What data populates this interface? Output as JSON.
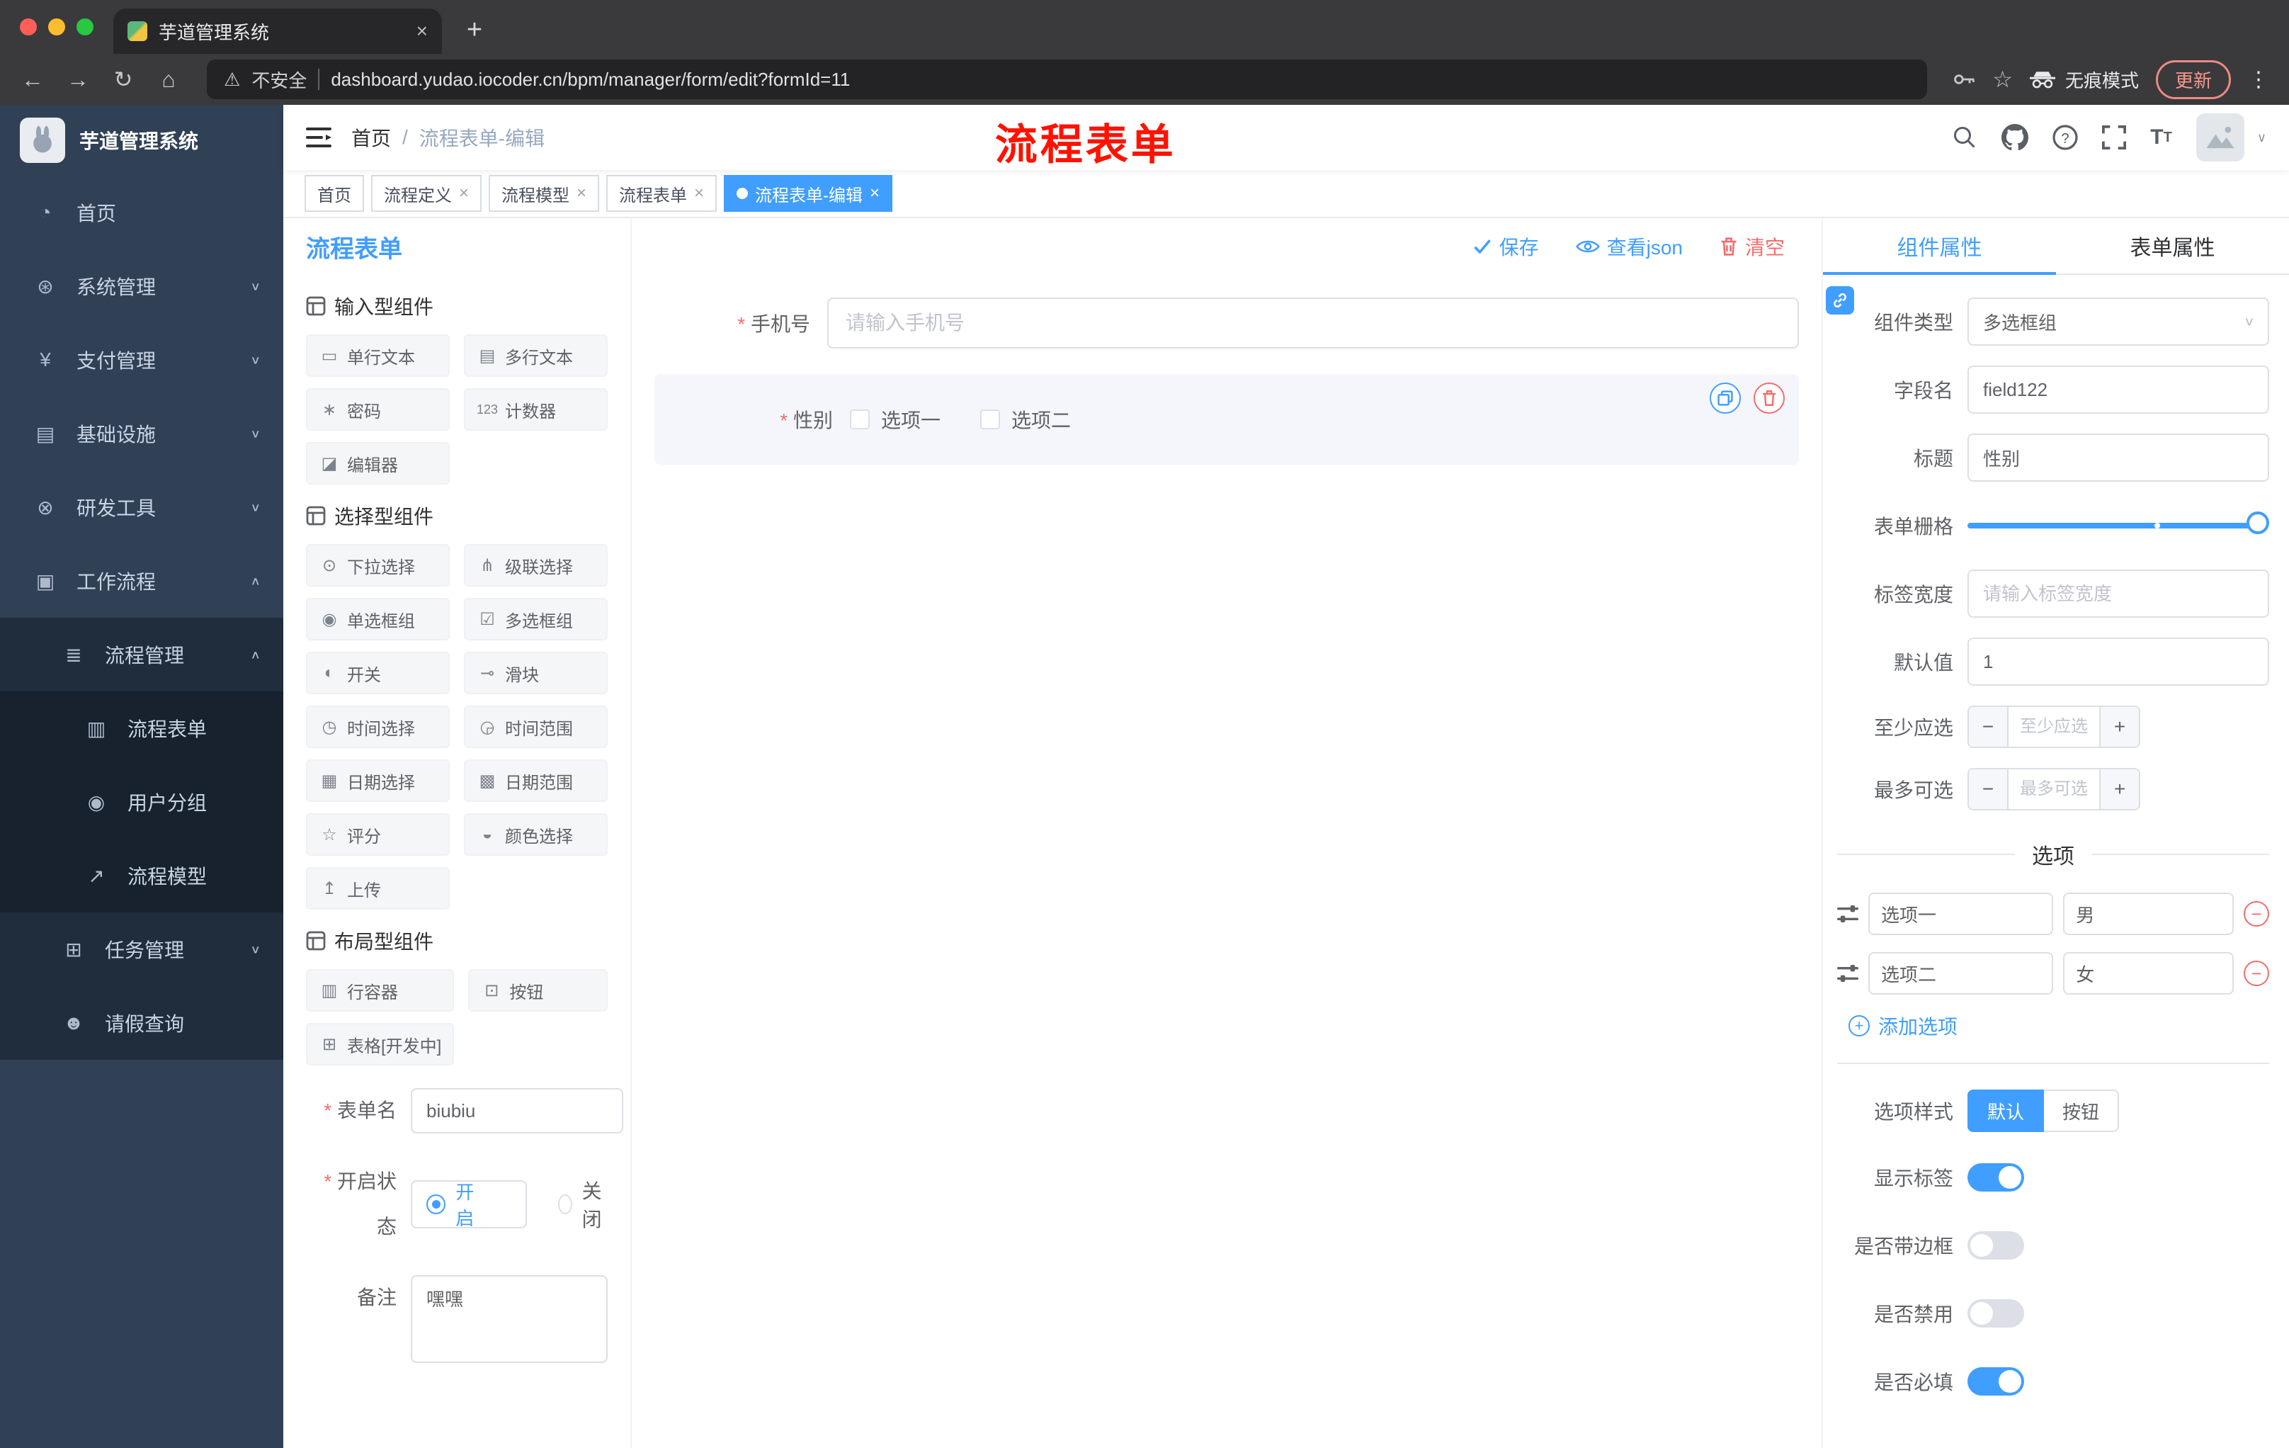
{
  "ui": {
    "close": "×",
    "plus": "+",
    "minus": "−",
    "chevron_down": "∨",
    "chevron_up": "∧",
    "kebab": "⋮",
    "warning": "⚠",
    "star": "☆",
    "nav_back": "←",
    "nav_forward": "→",
    "nav_reload": "↻",
    "nav_home": "⌂",
    "new_tab": "+",
    "caret": "∨"
  },
  "colors": {
    "accent": "#409eff",
    "danger": "#f56c6c",
    "sidebar": "#304156",
    "annotation": "#fe1200"
  },
  "browser": {
    "tab_title": "芋道管理系统",
    "security": "不安全",
    "url": "dashboard.yudao.iocoder.cn/bpm/manager/form/edit?formId=11",
    "incognito": "无痕模式",
    "update": "更新"
  },
  "sidebar": {
    "title": "芋道管理系统",
    "items": [
      {
        "glyph": "◔",
        "label": "首页"
      },
      {
        "glyph": "⊛",
        "label": "系统管理",
        "arrow": "∨"
      },
      {
        "glyph": "¥",
        "label": "支付管理",
        "arrow": "∨"
      },
      {
        "glyph": "▤",
        "label": "基础设施",
        "arrow": "∨"
      },
      {
        "glyph": "⊗",
        "label": "研发工具",
        "arrow": "∨"
      },
      {
        "glyph": "▣",
        "label": "工作流程",
        "arrow": "∧"
      },
      {
        "glyph": "≣",
        "label": "流程管理",
        "arrow": "∧"
      },
      {
        "glyph": "▥",
        "label": "流程表单"
      },
      {
        "glyph": "◉",
        "label": "用户分组"
      },
      {
        "glyph": "↗",
        "label": "流程模型"
      },
      {
        "glyph": "⊞",
        "label": "任务管理",
        "arrow": "∨"
      },
      {
        "glyph": "☻",
        "label": "请假查询"
      }
    ]
  },
  "header": {
    "breadcrumb_home": "首页",
    "breadcrumb_sep": "/",
    "breadcrumb_current": "流程表单-编辑",
    "annotation": "流程表单"
  },
  "tags": [
    {
      "label": "首页"
    },
    {
      "label": "流程定义"
    },
    {
      "label": "流程模型"
    },
    {
      "label": "流程表单"
    },
    {
      "label": "流程表单-编辑"
    }
  ],
  "designer": {
    "title": "流程表单",
    "save": "保存",
    "view_json": "查看json",
    "clear": "清空",
    "groups": [
      {
        "title": "输入型组件",
        "items": [
          {
            "glyph": "▭",
            "label": "单行文本"
          },
          {
            "glyph": "▤",
            "label": "多行文本"
          },
          {
            "glyph": "∗",
            "label": "密码"
          },
          {
            "glyph": "123",
            "label": "计数器"
          },
          {
            "glyph": "◪",
            "label": "编辑器"
          }
        ]
      },
      {
        "title": "选择型组件",
        "items": [
          {
            "glyph": "⊙",
            "label": "下拉选择"
          },
          {
            "glyph": "⋔",
            "label": "级联选择"
          },
          {
            "glyph": "◉",
            "label": "单选框组"
          },
          {
            "glyph": "☑",
            "label": "多选框组"
          },
          {
            "glyph": "◐",
            "label": "开关"
          },
          {
            "glyph": "⊸",
            "label": "滑块"
          },
          {
            "glyph": "◷",
            "label": "时间选择"
          },
          {
            "glyph": "◶",
            "label": "时间范围"
          },
          {
            "glyph": "▦",
            "label": "日期选择"
          },
          {
            "glyph": "▩",
            "label": "日期范围"
          },
          {
            "glyph": "☆",
            "label": "评分"
          },
          {
            "glyph": "◒",
            "label": "颜色选择"
          },
          {
            "glyph": "↥",
            "label": "上传"
          }
        ]
      },
      {
        "title": "布局型组件",
        "items": [
          {
            "glyph": "▥",
            "label": "行容器"
          },
          {
            "glyph": "⊡",
            "label": "按钮"
          },
          {
            "glyph": "⊞",
            "label": "表格[开发中]"
          }
        ]
      }
    ],
    "meta": {
      "name_label": "表单名",
      "name_value": "biubiu",
      "status_label": "开启状态",
      "on": "开启",
      "off": "关闭",
      "remark_label": "备注",
      "remark_value": "嘿嘿"
    },
    "canvas": {
      "phone_label": "手机号",
      "phone_placeholder": "请输入手机号",
      "gender_label": "性别",
      "opt1": "选项一",
      "opt2": "选项二"
    }
  },
  "props": {
    "tab_component": "组件属性",
    "tab_form": "表单属性",
    "rows": {
      "type_label": "组件类型",
      "type_value": "多选框组",
      "field_label": "字段名",
      "field_value": "field122",
      "title_label": "标题",
      "title_value": "性别",
      "grid_label": "表单栅格",
      "label_width_label": "标签宽度",
      "label_width_placeholder": "请输入标签宽度",
      "default_label": "默认值",
      "default_value": "1",
      "min_label": "至少应选",
      "min_placeholder": "至少应选",
      "max_label": "最多可选",
      "max_placeholder": "最多可选"
    },
    "options": {
      "title": "选项",
      "rows": [
        {
          "label": "选项一",
          "value": "男"
        },
        {
          "label": "选项二",
          "value": "女"
        }
      ],
      "add": "添加选项"
    },
    "style": {
      "label": "选项样式",
      "default": "默认",
      "button": "按钮"
    },
    "switches": [
      {
        "label": "显示标签",
        "on": true
      },
      {
        "label": "是否带边框",
        "on": false
      },
      {
        "label": "是否禁用",
        "on": false
      },
      {
        "label": "是否必填",
        "on": true
      }
    ]
  }
}
